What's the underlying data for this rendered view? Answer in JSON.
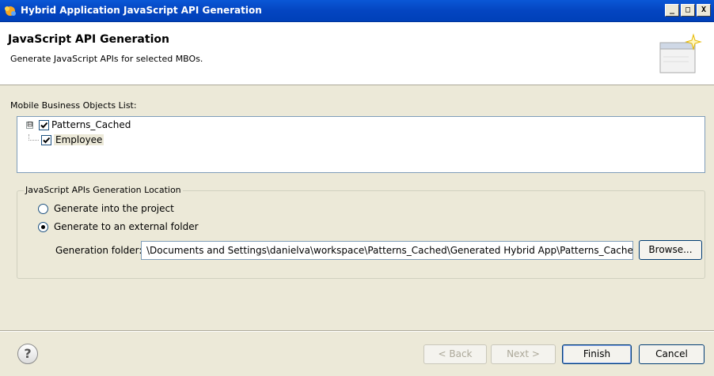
{
  "window": {
    "title": "Hybrid Application JavaScript API Generation",
    "controls": {
      "minimize": "_",
      "maximize": "□",
      "close": "X"
    }
  },
  "header": {
    "title": "JavaScript API Generation",
    "description": "Generate JavaScript APIs for selected MBOs.",
    "icon": "wizard-banner-icon"
  },
  "mbo_list": {
    "label": "Mobile Business Objects List:",
    "items": [
      {
        "label": "Patterns_Cached",
        "checked": true,
        "expanded": true,
        "expander": "⊟"
      },
      {
        "label": "Employee",
        "checked": true,
        "selected": true
      }
    ]
  },
  "location": {
    "legend": "JavaScript APIs Generation Location",
    "options": [
      {
        "label": "Generate into the project",
        "selected": false
      },
      {
        "label": "Generate to an external folder",
        "selected": true
      }
    ],
    "folder_label": "Generation folder:",
    "folder_value": "\\Documents and Settings\\danielva\\workspace\\Patterns_Cached\\Generated Hybrid App\\Patterns_Cached\\",
    "folder_selected": "html",
    "browse_label": "Browse..."
  },
  "footer": {
    "help": "?",
    "back_label": "< Back",
    "next_label": "Next >",
    "finish_label": "Finish",
    "cancel_label": "Cancel"
  },
  "colors": {
    "titlebar": "#0445c1",
    "selection": "#0a246a",
    "dialog_bg": "#ece9d8"
  }
}
